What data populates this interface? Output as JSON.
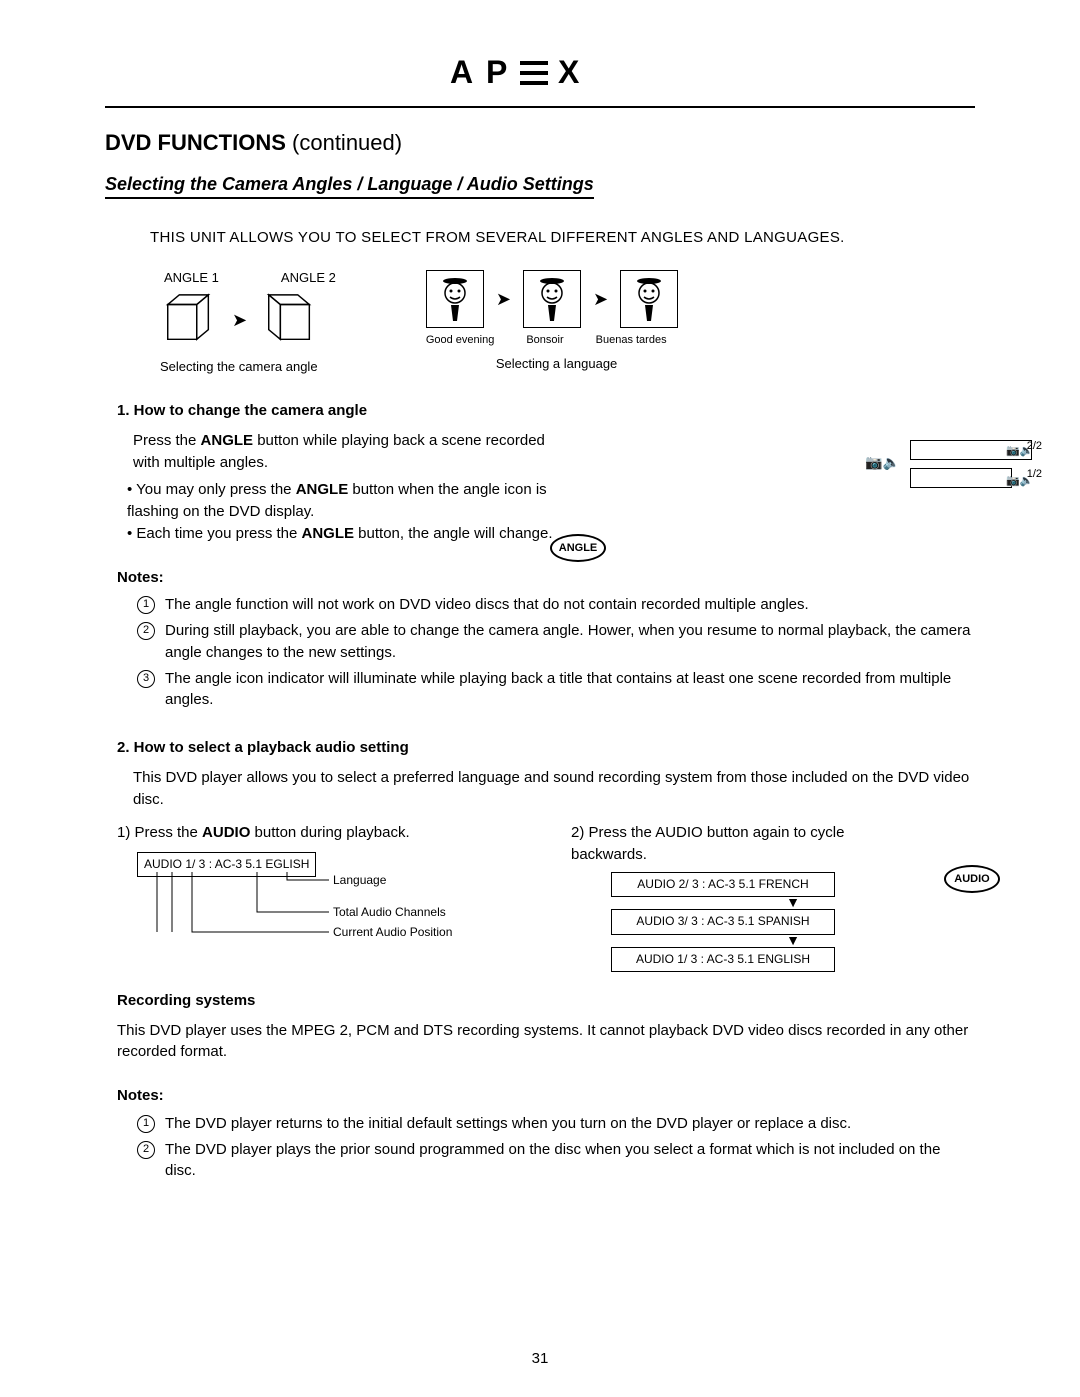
{
  "brand": "APEX",
  "header": {
    "title": "DVD FUNCTIONS",
    "continued": "(continued)"
  },
  "subheading": "Selecting the Camera Angles / Language / Audio Settings",
  "intro": "THIS  UNIT ALLOWS YOU TO SELECT FROM SEVERAL DIFFERENT ANGLES AND LANGUAGES.",
  "angle_diagram": {
    "label1": "ANGLE 1",
    "label2": "ANGLE 2",
    "caption": "Selecting the camera angle"
  },
  "lang_diagram": {
    "label1": "Good evening",
    "label2": "Bonsoir",
    "label3": "Buenas tardes",
    "caption": "Selecting a language"
  },
  "step1": {
    "heading": "1. How to change the camera angle",
    "press_pre": "Press the ",
    "press_bold": "ANGLE",
    "press_post": " button while playing back a scene recorded with multiple angles.",
    "bullet1_pre": "You may only press the ",
    "bullet1_bold": "ANGLE",
    "bullet1_post": " button when the angle icon is flashing on the DVD display.",
    "bullet2_pre": "Each time you press the ",
    "bullet2_bold": "ANGLE",
    "bullet2_post": " button, the angle will change."
  },
  "osd": {
    "top": "2/2",
    "bottom": "1/2"
  },
  "notes1": {
    "heading": "Notes:",
    "n1": "The angle function will not work on DVD video discs that do not contain recorded multiple angles.",
    "n2": "During still playback, you are able to change the camera angle. Hower, when you resume to normal playback, the camera angle changes to the new settings.",
    "n3": "The angle icon indicator will illuminate while playing back a title that contains at least one scene recorded from multiple angles."
  },
  "step2": {
    "heading": "2. How to select a playback audio setting",
    "body": "This DVD player allows you to select a preferred language and sound recording system from those included on the DVD video disc.",
    "left_step_pre": "1) Press the ",
    "left_step_bold": "AUDIO",
    "left_step_post": " button during playback.",
    "right_step": "2) Press the AUDIO button again to cycle backwards."
  },
  "audio_left": {
    "box": "AUDIO 1/ 3 : AC-3 5.1 EGLISH",
    "lbl_language": "Language",
    "lbl_channels": "Total Audio Channels",
    "lbl_position": "Current Audio Position"
  },
  "audio_right": {
    "b1": "AUDIO 2/ 3 : AC-3  5.1 FRENCH",
    "b2": "AUDIO 3/ 3 : AC-3  5.1 SPANISH",
    "b3": "AUDIO 1/ 3 : AC-3  5.1 ENGLISH"
  },
  "rec": {
    "heading": "Recording systems",
    "body": "This DVD player uses the MPEG 2, PCM and DTS recording systems. It cannot playback DVD video discs recorded in any other recorded format."
  },
  "notes2": {
    "heading": "Notes:",
    "n1": "The DVD player returns to the initial default settings when you turn on the DVD player or replace a disc.",
    "n2": "The DVD player plays the prior sound programmed on the disc when you select a format which is not included on the disc."
  },
  "buttons": {
    "angle": "ANGLE",
    "audio": "AUDIO"
  },
  "page_number": "31"
}
